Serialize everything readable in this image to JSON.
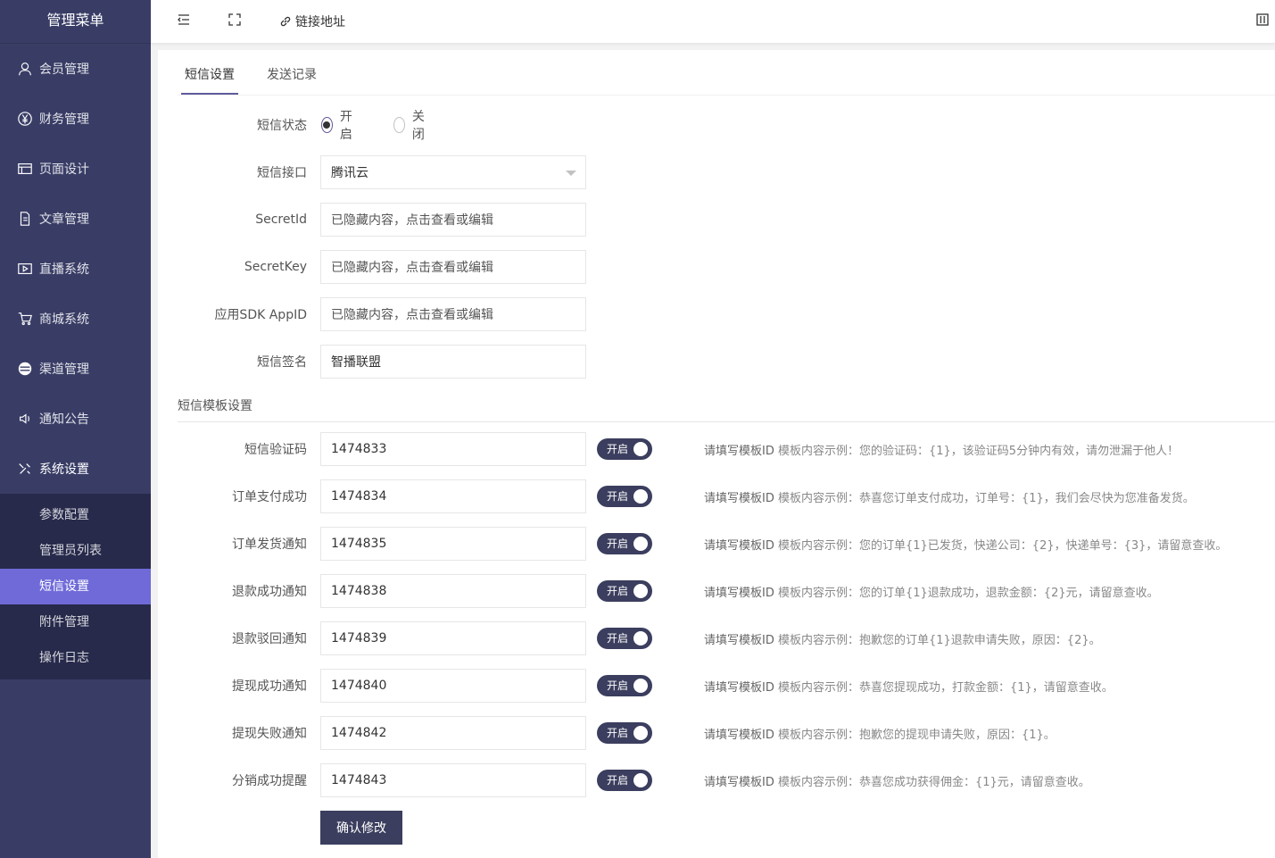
{
  "sidebar": {
    "title": "管理菜单",
    "items": [
      {
        "label": "会员管理",
        "icon": "user-icon"
      },
      {
        "label": "财务管理",
        "icon": "yen-icon"
      },
      {
        "label": "页面设计",
        "icon": "layout-icon"
      },
      {
        "label": "文章管理",
        "icon": "document-icon"
      },
      {
        "label": "直播系统",
        "icon": "video-icon"
      },
      {
        "label": "商城系统",
        "icon": "cart-icon"
      },
      {
        "label": "渠道管理",
        "icon": "channel-icon"
      },
      {
        "label": "通知公告",
        "icon": "speaker-icon"
      },
      {
        "label": "系统设置",
        "icon": "tools-icon"
      }
    ],
    "submenu": [
      "参数配置",
      "管理员列表",
      "短信设置",
      "附件管理",
      "操作日志"
    ],
    "active_sub": "短信设置"
  },
  "topbar": {
    "link_label": "链接地址"
  },
  "tabs": [
    "短信设置",
    "发送记录"
  ],
  "form": {
    "status_label": "短信状态",
    "status_on": "开启",
    "status_off": "关闭",
    "interface_label": "短信接口",
    "interface_value": "腾讯云",
    "secretid_label": "SecretId",
    "secretid_value": "已隐藏内容，点击查看或编辑",
    "secretkey_label": "SecretKey",
    "secretkey_value": "已隐藏内容，点击查看或编辑",
    "appid_label": "应用SDK AppID",
    "appid_value": "已隐藏内容，点击查看或编辑",
    "sign_label": "短信签名",
    "sign_value": "智播联盟"
  },
  "template_section_title": "短信模板设置",
  "templates": [
    {
      "label": "短信验证码",
      "value": "1474833",
      "switch": "开启",
      "tip_prefix": "请填写模板ID",
      "tip": " 模板内容示例：您的验证码：{1}，该验证码5分钟内有效，请勿泄漏于他人！"
    },
    {
      "label": "订单支付成功",
      "value": "1474834",
      "switch": "开启",
      "tip_prefix": "请填写模板ID",
      "tip": " 模板内容示例：恭喜您订单支付成功，订单号：{1}，我们会尽快为您准备发货。"
    },
    {
      "label": "订单发货通知",
      "value": "1474835",
      "switch": "开启",
      "tip_prefix": "请填写模板ID",
      "tip": " 模板内容示例：您的订单{1}已发货，快递公司：{2}，快递单号：{3}，请留意查收。"
    },
    {
      "label": "退款成功通知",
      "value": "1474838",
      "switch": "开启",
      "tip_prefix": "请填写模板ID",
      "tip": " 模板内容示例：您的订单{1}退款成功，退款金额：{2}元，请留意查收。"
    },
    {
      "label": "退款驳回通知",
      "value": "1474839",
      "switch": "开启",
      "tip_prefix": "请填写模板ID",
      "tip": " 模板内容示例：抱歉您的订单{1}退款申请失败，原因：{2}。"
    },
    {
      "label": "提现成功通知",
      "value": "1474840",
      "switch": "开启",
      "tip_prefix": "请填写模板ID",
      "tip": " 模板内容示例：恭喜您提现成功，打款金额：{1}，请留意查收。"
    },
    {
      "label": "提现失败通知",
      "value": "1474842",
      "switch": "开启",
      "tip_prefix": "请填写模板ID",
      "tip": " 模板内容示例：抱歉您的提现申请失败，原因：{1}。"
    },
    {
      "label": "分销成功提醒",
      "value": "1474843",
      "switch": "开启",
      "tip_prefix": "请填写模板ID",
      "tip": " 模板内容示例：恭喜您成功获得佣金：{1}元，请留意查收。"
    }
  ],
  "submit_label": "确认修改"
}
